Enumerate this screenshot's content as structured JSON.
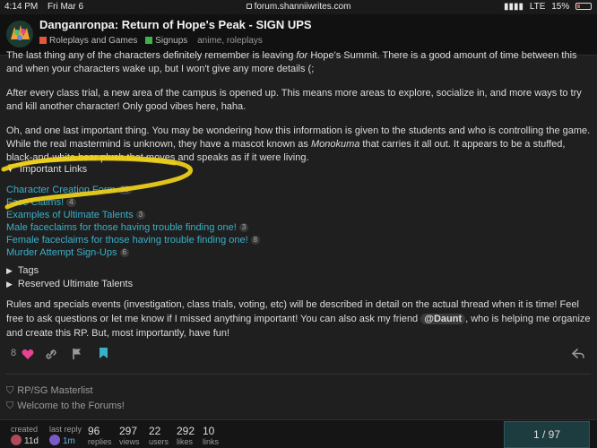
{
  "status_bar": {
    "time": "4:14 PM",
    "date": "Fri Mar 6",
    "url": "forum.shanniiwrites.com",
    "network": "LTE",
    "battery": "15%"
  },
  "topic": {
    "title": "Danganronpa: Return of Hope's Peak - SIGN UPS",
    "category": "Roleplays and Games",
    "subcategory": "Signups",
    "tags": "anime, roleplays",
    "category_color": "#e45735",
    "subcategory_color": "#3ab54a"
  },
  "post": {
    "para_top": "The last thing any of the characters definitely remember is leaving ",
    "para_top_em": "for",
    "para_top_rest": " Hope's Summit. There is a good amount of time between this and when your characters wake up, but I won't give any more details (;",
    "para_1": "After every class trial, a new area of the campus is opened up. This means more areas to explore, socialize in, and more ways to try and kill another character! Only good vibes here, haha.",
    "para_2_a": "Oh, and one last important thing. You may be wondering how this information is given to the students and who is controlling the game. While the real mastermind is unknown, they have a mascot known as ",
    "para_2_em": "Monokuma",
    "para_2_b": " that carries it all out. It appears to be a stuffed, black-and-white bear plush that moves and speaks as if it were living.",
    "important_links_label": "Important Links",
    "links": [
      {
        "text": "Character Creation Form",
        "count": "10"
      },
      {
        "text": "Face Claims!",
        "count": "4"
      },
      {
        "text": "Examples of Ultimate Talents",
        "count": "3"
      },
      {
        "text": "Male faceclaims for those having trouble finding one!",
        "count": "3"
      },
      {
        "text": "Female faceclaims for those having trouble finding one!",
        "count": "8"
      },
      {
        "text": "Murder Attempt Sign-Ups",
        "count": "6"
      }
    ],
    "tags_label": "Tags",
    "reserved_label": "Reserved Ultimate Talents",
    "closing_a": "Rules and specials events (investigation, class trials, voting, etc) will be described in detail on the actual thread when it is time! Feel free to ask questions or let me know if I missed anything important! You can also ask my friend ",
    "mention": "@Daunt",
    "closing_b": ", who is helping me organize and create this RP. But, most importantly, have fun!"
  },
  "actions": {
    "like_count": "8",
    "like_color": "#e84393",
    "bookmark_color": "#3ab0c8"
  },
  "related": [
    {
      "label": "RP/SG Masterlist",
      "icon": "shield-icon"
    },
    {
      "label": "Welcome to the Forums!",
      "icon": "shield-icon"
    }
  ],
  "footer": {
    "created_label": "created",
    "created_value": "11d",
    "last_reply_label": "last reply",
    "last_reply_value": "1m",
    "replies_value": "96",
    "replies_label": "replies",
    "views_value": "297",
    "views_label": "views",
    "users_value": "22",
    "users_label": "users",
    "likes_value": "292",
    "likes_label": "likes",
    "links_value": "10",
    "links_label": "links",
    "progress": "1 / 97"
  }
}
